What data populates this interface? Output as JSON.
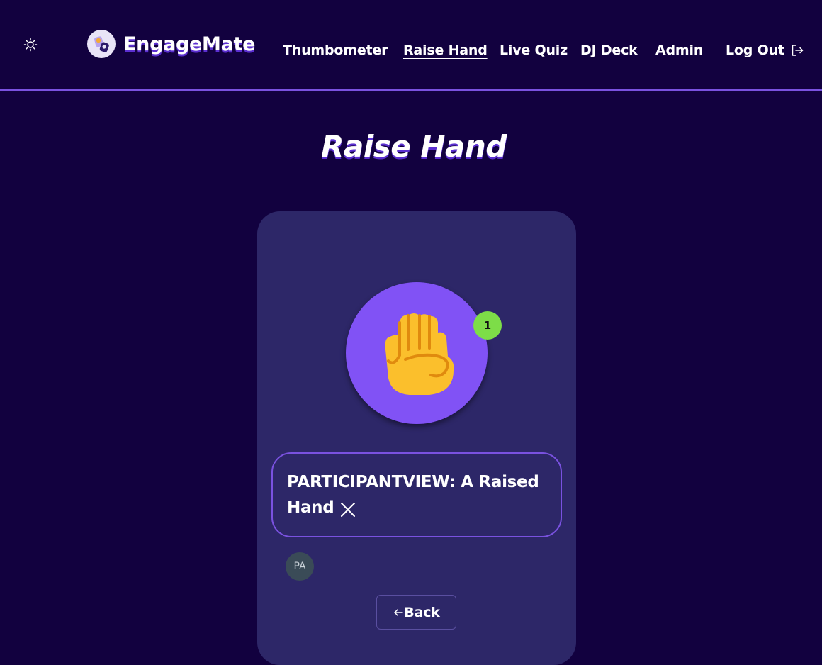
{
  "header": {
    "brand": "EngageMate",
    "theme_icon": "sun-icon",
    "nav": [
      {
        "label": "Thumbometer"
      },
      {
        "label": "Raise Hand",
        "active": true
      },
      {
        "label": "Live Quiz"
      },
      {
        "label": "DJ Deck"
      },
      {
        "label": "Admin"
      }
    ],
    "logout_label": "Log Out",
    "logout_icon": "logout-icon"
  },
  "main": {
    "title": "Raise Hand",
    "hand_icon": "raised-fist-icon",
    "raised_count": "1",
    "status_text": "PARTICIPANTVIEW: A Raised Hand",
    "avatar_initials": "PA",
    "back_label": "Back"
  },
  "colors": {
    "background": "#12013f",
    "accent": "#8152f5",
    "card": "#2d2768",
    "badge": "#7ddd48",
    "border": "#7a52e0"
  }
}
